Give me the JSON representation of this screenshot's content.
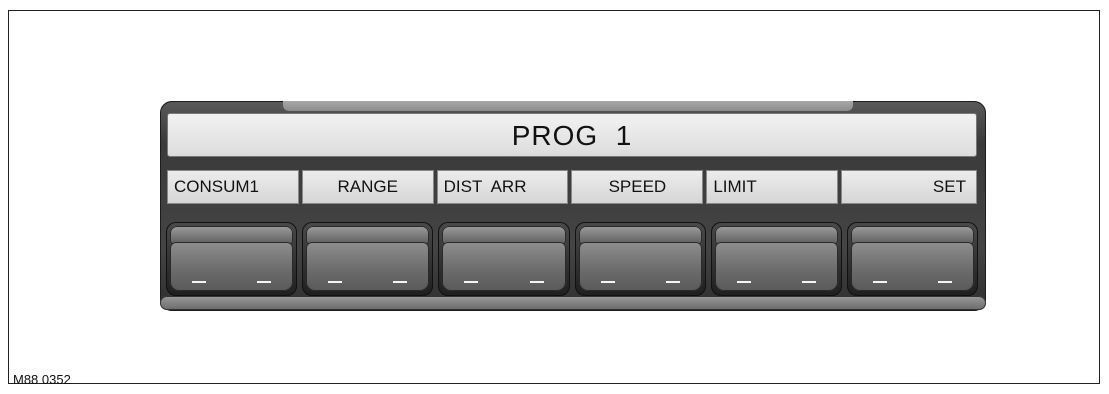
{
  "display": {
    "text": "PROG  1"
  },
  "function_labels": [
    {
      "text": "CONSUM1",
      "align": "left"
    },
    {
      "text": "RANGE",
      "align": "center"
    },
    {
      "text": "DIST  ARR",
      "align": "left"
    },
    {
      "text": "SPEED",
      "align": "center"
    },
    {
      "text": "LIMIT",
      "align": "left"
    },
    {
      "text": "SET",
      "align": "right"
    }
  ],
  "button_count": 6,
  "figure_id": "M88 0352",
  "colors": {
    "housing": "#3a3a3a",
    "display_background": "#e6e6e6",
    "button_face": "#7a7a7a",
    "button_marking": "#f4f4f4"
  }
}
